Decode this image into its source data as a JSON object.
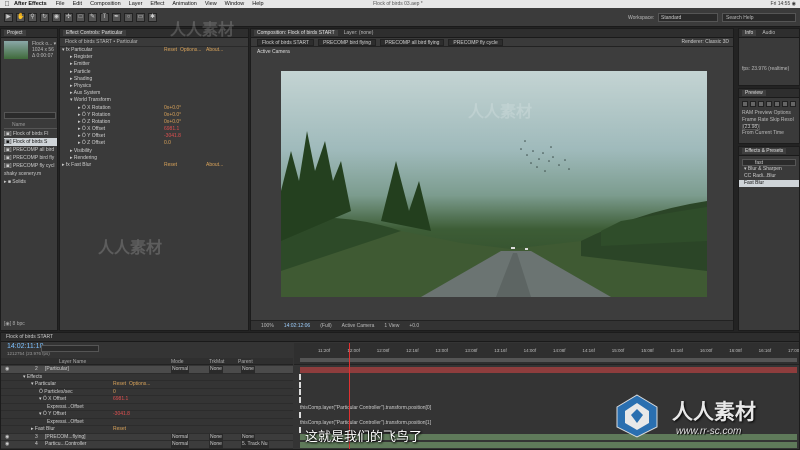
{
  "menubar": {
    "apple": "",
    "app": "After Effects",
    "items": [
      "File",
      "Edit",
      "Composition",
      "Layer",
      "Effect",
      "Animation",
      "View",
      "Window",
      "Help"
    ],
    "title": "Flock of birds 03.aep *",
    "right": "Fri 14:55  ◉"
  },
  "toolbar": {
    "workspace_label": "Workspace:",
    "workspace_value": "Standard",
    "search_placeholder": "Search Help"
  },
  "project": {
    "tab": "Project",
    "info_lines": [
      "Flock o... ▾",
      "1024 x 56",
      "Δ 0:00:07"
    ],
    "column": "Name",
    "rows": [
      {
        "label": "[▣] Flock of birds FI",
        "selected": false
      },
      {
        "label": "[▣] Flock of birds S",
        "selected": true
      },
      {
        "label": "[▣] PRECOMP all bird",
        "selected": false
      },
      {
        "label": "[▣] PRECOMP bird fly",
        "selected": false
      },
      {
        "label": "[▣] PRECOMP fly cycl",
        "selected": false
      },
      {
        "label": "    shaky scenery.m",
        "selected": false
      },
      {
        "label": "▸ ■ Solids",
        "selected": false
      }
    ],
    "footer": "[◉] 8 bpc"
  },
  "effects": {
    "tab": "Effect Controls: Particular",
    "subhead": "Flock of birds START • Particular",
    "rows": [
      {
        "indent": 2,
        "label": "▾ fx  Particular",
        "reset": "Reset",
        "options": "Options...",
        "about": "About..."
      },
      {
        "indent": 10,
        "label": "▸ Register"
      },
      {
        "indent": 10,
        "label": "▸ Emitter"
      },
      {
        "indent": 10,
        "label": "▸ Particle"
      },
      {
        "indent": 10,
        "label": "▸ Shading"
      },
      {
        "indent": 10,
        "label": "▸ Physics"
      },
      {
        "indent": 10,
        "label": "▸ Aux System"
      },
      {
        "indent": 10,
        "label": "▾ World Transform"
      },
      {
        "indent": 18,
        "label": "▸ Ö X Rotation",
        "value": "0x+0.0°"
      },
      {
        "indent": 18,
        "label": "▸ Ö Y Rotation",
        "value": "0x+0.0°"
      },
      {
        "indent": 18,
        "label": "▸ Ö Z Rotation",
        "value": "0x+0.0°"
      },
      {
        "indent": 18,
        "label": "▸ Ö X Offset",
        "value": "6981.1",
        "red": true
      },
      {
        "indent": 18,
        "label": "▸ Ö Y Offset",
        "value": "-3041.8",
        "red": true
      },
      {
        "indent": 18,
        "label": "▸ Ö Z Offset",
        "value": "0.0"
      },
      {
        "indent": 10,
        "label": "▸ Visibility"
      },
      {
        "indent": 10,
        "label": "▸ Rendering"
      },
      {
        "indent": 2,
        "label": "▸ fx  Fast Blur",
        "reset": "Reset",
        "about": "About..."
      }
    ]
  },
  "comp": {
    "tab_main": "Composition: Flock of birds START",
    "tab_layer": "Layer: (none)",
    "subtabs": [
      "Flock of birds START",
      "PRECOMP bird flying",
      "PRECOMP all bird flying",
      "PRECOMP fly cycle"
    ],
    "renderer": "Renderer:  Classic 3D",
    "active_camera": "Active Camera",
    "footer": {
      "zoom": "100%",
      "timecode": "14:02:12:06",
      "resolution": "(Full)",
      "camera": "Active Camera",
      "views": "1 View",
      "exposure": "+0.0"
    }
  },
  "info_panel": {
    "tabs": [
      "Info",
      "Audio"
    ],
    "fps": "fps: 23.976 (realtime)"
  },
  "preview": {
    "tab": "Preview",
    "ram_label": "RAM Preview Options",
    "frame_rate_label": "Frame Rate  Skip  Resol",
    "frame_rate_value": "(23.98)",
    "from_current": "From Current Time"
  },
  "effects_presets": {
    "tab": "Effects & Presets",
    "search_value": "fast",
    "rows": [
      {
        "label": "▾ Blur & Sharpen",
        "selected": false
      },
      {
        "label": "   CC Radi...Blur",
        "selected": false
      },
      {
        "label": "   Fast Blur",
        "selected": true
      }
    ]
  },
  "timeline": {
    "tab": "Flock of birds START",
    "timecode": "14:02:11:10",
    "timecode_small": "1212754 (23.976 fps)",
    "columns": [
      "Layer Name",
      "Mode",
      "TrkMat",
      "Parent"
    ],
    "ticks": [
      "11:20f",
      "12:00f",
      "12:08f",
      "12:16f",
      "13:00f",
      "13:08f",
      "13:16f",
      "14:00f",
      "14:08f",
      "14:16f",
      "15:00f",
      "15:08f",
      "15:16f",
      "16:00f",
      "16:08f",
      "16:16f",
      "17:00f"
    ],
    "rows": [
      {
        "type": "layer",
        "num": "2",
        "name": "[Particular]",
        "mode": "Normal",
        "trkmat": "None",
        "parent": "None"
      },
      {
        "type": "prop",
        "indent": 22,
        "label": "▾ Effects"
      },
      {
        "type": "prop",
        "indent": 30,
        "label": "▾ Particular",
        "reset": "Reset",
        "options": "Options..."
      },
      {
        "type": "prop",
        "indent": 38,
        "label": "Ö Particles/sec",
        "value": "0"
      },
      {
        "type": "prop",
        "indent": 38,
        "label": "▾ Ö X Offset",
        "value": "6981.1",
        "red": true
      },
      {
        "type": "prop",
        "indent": 46,
        "label": "Expressi...Offset",
        "expr": "thisComp.layer(\"Particular Controller\").transform.position[0]"
      },
      {
        "type": "prop",
        "indent": 38,
        "label": "▾ Ö Y Offset",
        "value": "-3041.8",
        "red": true
      },
      {
        "type": "prop",
        "indent": 46,
        "label": "Expressi...Offset",
        "expr": "thisComp.layer(\"Particular Controller\").transform.position[1]"
      },
      {
        "type": "prop",
        "indent": 30,
        "label": "▸ Fast Blur",
        "reset": "Reset"
      },
      {
        "type": "layer",
        "num": "3",
        "name": "[PRECOM...flying]",
        "mode": "Normal",
        "trkmat": "None",
        "parent": "None"
      },
      {
        "type": "layer",
        "num": "4",
        "name": "Particu...Controller",
        "mode": "Normal",
        "trkmat": "None",
        "parent": "5. Track Nu"
      }
    ]
  },
  "overlay": {
    "subtitle": "这就是我们的飞鸟了",
    "brand": "人人素材",
    "url": "www.rr-sc.com",
    "watermarks": [
      "人人素材",
      "人人素材",
      "人人素材"
    ]
  },
  "colors": {
    "accent_value": "#d9a35a",
    "keyframed_value": "#e05050",
    "timecode": "#7dc1ff",
    "current_time_indicator": "#e03030",
    "layer_bar_red": "#8e3d3d",
    "layer_bar_green": "#5f7a5a"
  }
}
